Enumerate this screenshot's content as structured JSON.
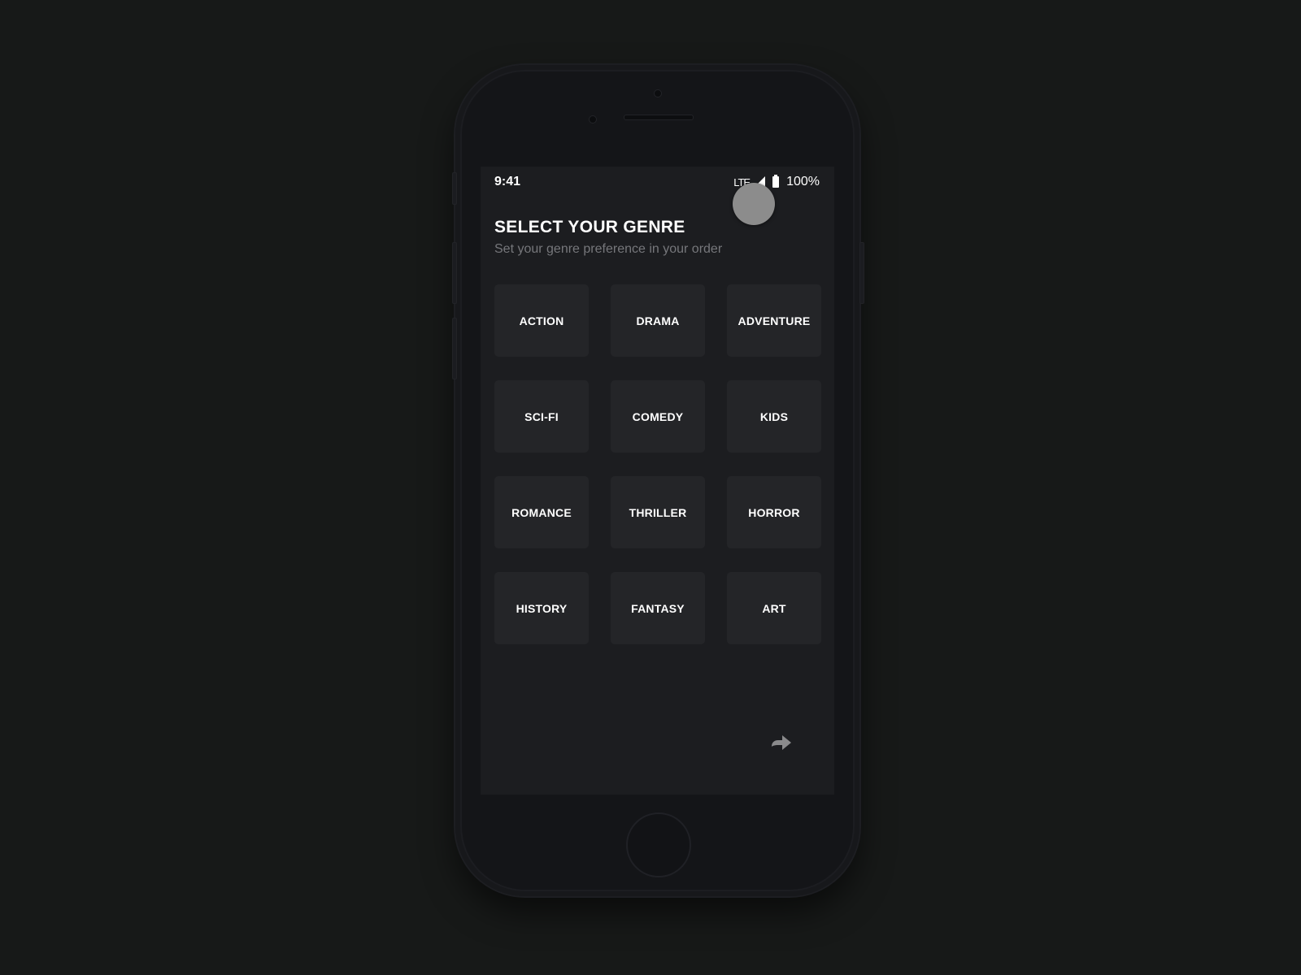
{
  "status_bar": {
    "time": "9:41",
    "network": "LTE",
    "battery": "100%"
  },
  "header": {
    "title": "SELECT YOUR GENRE",
    "subtitle": "Set your genre preference in your order"
  },
  "genres": [
    {
      "label": "ACTION"
    },
    {
      "label": "DRAMA"
    },
    {
      "label": "ADVENTURE"
    },
    {
      "label": "SCI-FI"
    },
    {
      "label": "COMEDY"
    },
    {
      "label": "KIDS"
    },
    {
      "label": "ROMANCE"
    },
    {
      "label": "THRILLER"
    },
    {
      "label": "HORROR"
    },
    {
      "label": "HISTORY"
    },
    {
      "label": "FANTASY"
    },
    {
      "label": "ART"
    }
  ],
  "next_button": {
    "icon": "arrow-right-icon"
  },
  "colors": {
    "background": "#171918",
    "screen": "#1c1d20",
    "tile": "#242528",
    "subtitle": "#76777b",
    "arrow": "#8a8a8c"
  }
}
